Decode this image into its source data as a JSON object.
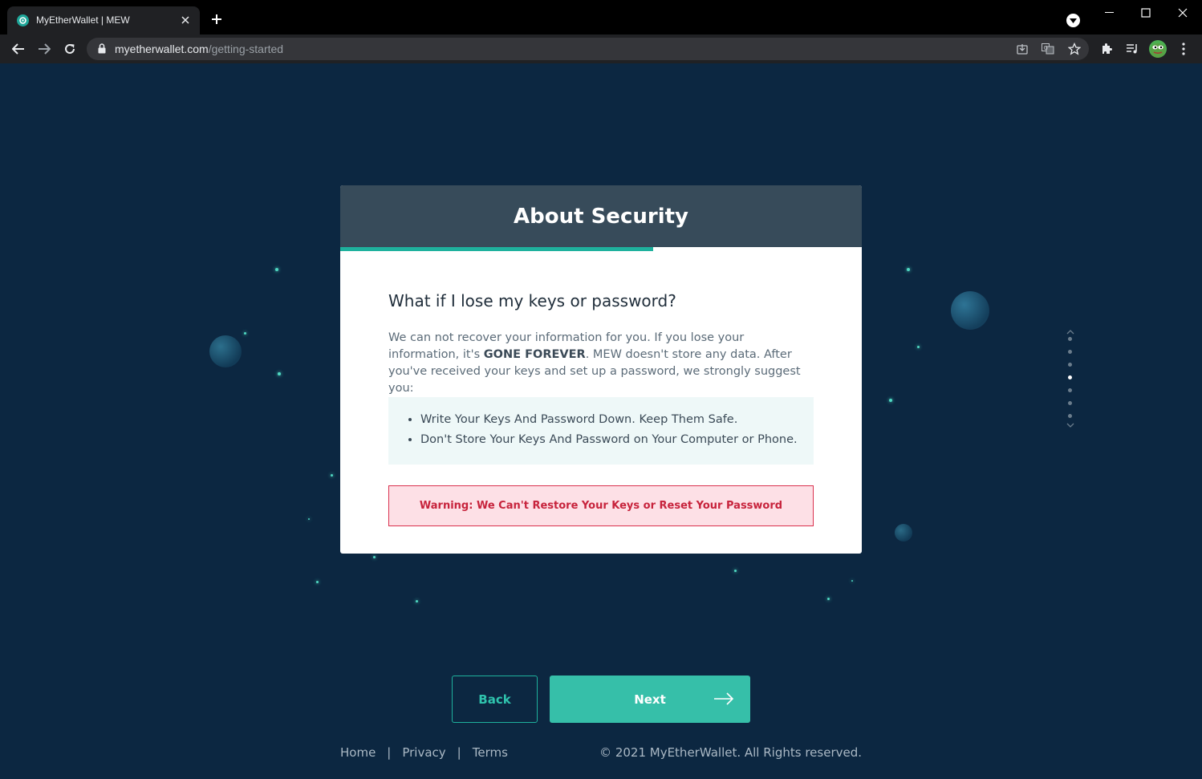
{
  "browser": {
    "tab_title": "MyEtherWallet | MEW",
    "url_host": "myetherwallet.com",
    "url_path": "/getting-started"
  },
  "card": {
    "title": "About Security",
    "progress_fraction": 0.6,
    "question": "What if I lose my keys or password?",
    "desc_part1": "We can not recover your information for you. If you lose your information, it's ",
    "desc_bold": "GONE FOREVER",
    "desc_part2": ". MEW doesn't store any data. After you've received your keys and set up a password, we strongly suggest you:",
    "tips": [
      "Write Your Keys And Password Down. Keep Them Safe.",
      "Don't Store Your Keys And Password on Your Computer or Phone."
    ],
    "warning": "Warning: We Can't Restore Your Keys or Reset Your Password"
  },
  "side_nav": {
    "total_steps": 7,
    "active_step": 3
  },
  "buttons": {
    "back": "Back",
    "next": "Next"
  },
  "footer": {
    "links": [
      "Home",
      "Privacy",
      "Terms"
    ],
    "copyright": "© 2021 MyEtherWallet. All Rights reserved."
  },
  "colors": {
    "background": "#0c2741",
    "card_header": "#374b5a",
    "accent": "#36bfa9",
    "warning_border": "#d9314d",
    "warning_bg": "#fde0e6"
  }
}
